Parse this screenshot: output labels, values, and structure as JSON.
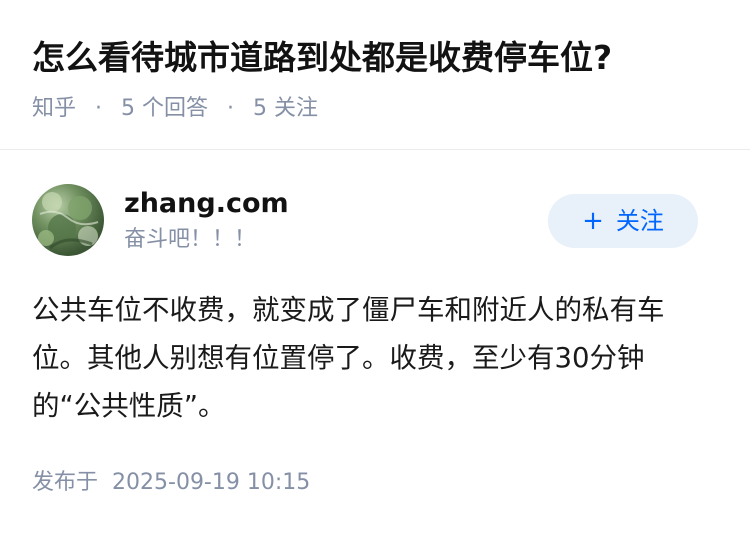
{
  "question": {
    "title": "怎么看待城市道路到处都是收费停车位?",
    "source": "知乎",
    "separator": "·",
    "answer_count": "5 个回答",
    "follower_count": "5 关注"
  },
  "author": {
    "name": "zhang.com",
    "bio": "奋斗吧！！！",
    "follow_label": "关注",
    "follow_icon": "plus-icon",
    "follow_icon_glyph": "+"
  },
  "answer": {
    "content": "公共车位不收费，就变成了僵尸车和附近人的私有车位。其他人别想有位置停了。收费，至少有30分钟的“公共性质”。",
    "published_label": "发布于",
    "published_time": "2025-09-19 10:15"
  },
  "colors": {
    "title": "#121212",
    "meta": "#8590a6",
    "follow_bg": "#e8f0fa",
    "follow_text": "#0066ff",
    "divider": "#ececec"
  }
}
